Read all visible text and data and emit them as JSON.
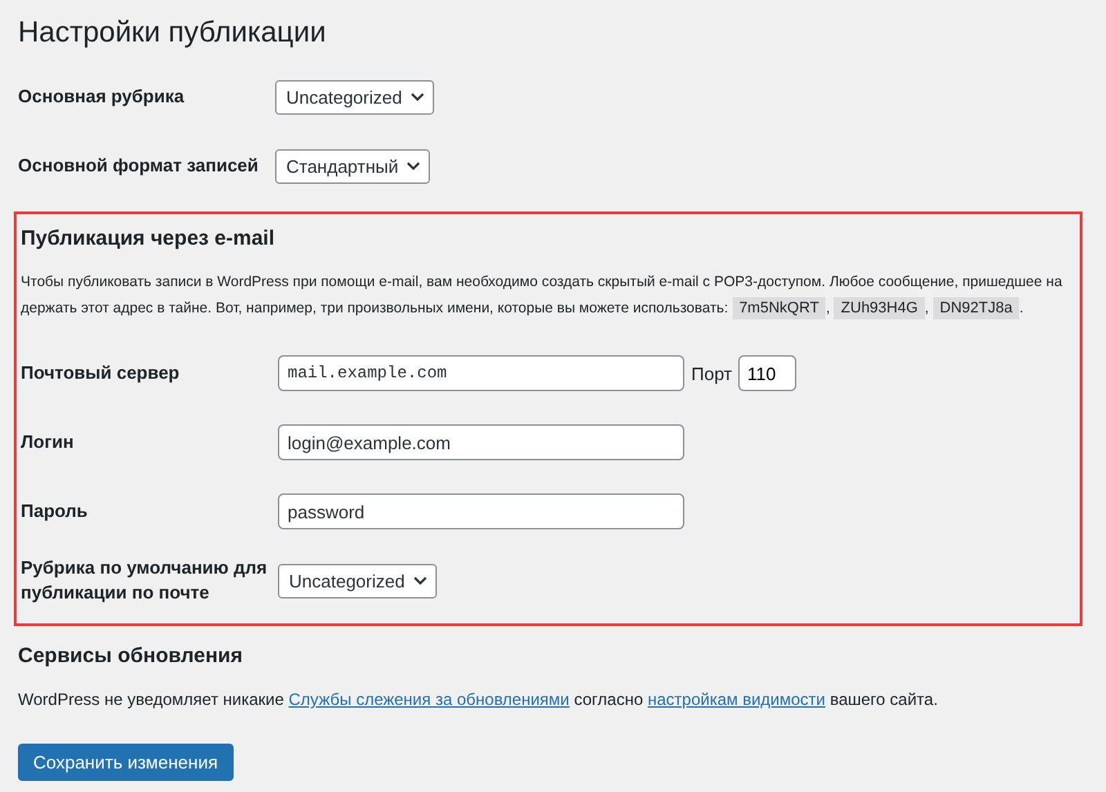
{
  "title": "Настройки публикации",
  "general_rows": [
    {
      "label": "Основная рубрика",
      "kind": "select",
      "value": "Uncategorized"
    },
    {
      "label": "Основной формат записей",
      "kind": "select",
      "value": "Стандартный"
    }
  ],
  "email_section": {
    "heading": "Публикация через e-mail",
    "highlighted": true,
    "description": [
      {
        "kind": "cut",
        "text": "Чтобы публиковать записи в WordPress при помощи e-mail, вам необходимо создать скрытый e-mail с POP3-доступом. Любое сообщение, пришедшее на"
      },
      {
        "kind": "text",
        "text": "держать этот адрес в тайне. Вот, например, три произвольных имени, которые вы можете использовать: "
      },
      {
        "kind": "code",
        "text": "7m5NkQRT"
      },
      {
        "kind": "text",
        "text": ", "
      },
      {
        "kind": "code",
        "text": "ZUh93H4G"
      },
      {
        "kind": "text",
        "text": ", "
      },
      {
        "kind": "code",
        "text": "DN92TJ8a"
      },
      {
        "kind": "text",
        "text": "."
      }
    ],
    "rows": [
      {
        "label": "Почтовый сервер",
        "kind": "code_input",
        "value": "mail.example.com",
        "port": {
          "label": "Порт",
          "value": "110"
        }
      },
      {
        "label": "Логин",
        "kind": "input",
        "value": "login@example.com"
      },
      {
        "label": "Пароль",
        "kind": "input",
        "value": "password"
      },
      {
        "label": "Рубрика по умолчанию для публикации по почте",
        "kind": "select",
        "value": "Uncategorized"
      }
    ]
  },
  "update_section": {
    "heading": "Сервисы обновления",
    "text": [
      {
        "kind": "text",
        "text": "WordPress не уведомляет никакие "
      },
      {
        "kind": "link",
        "text": "Службы слежения за обновлениями"
      },
      {
        "kind": "text",
        "text": " согласно "
      },
      {
        "kind": "link",
        "text": "настройкам видимости"
      },
      {
        "kind": "text",
        "text": " вашего сайта."
      }
    ]
  },
  "save_button": "Сохранить изменения"
}
